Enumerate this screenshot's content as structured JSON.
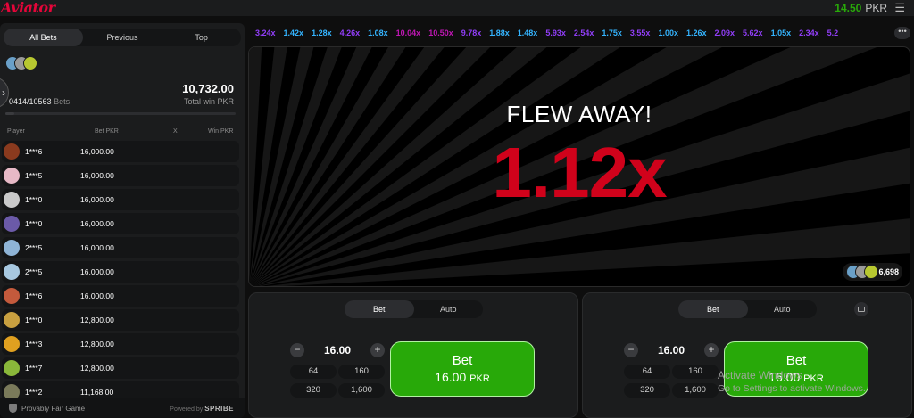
{
  "header": {
    "logo": "Aviator",
    "balance": "14.50",
    "currency": "PKR"
  },
  "left_panel": {
    "tabs": [
      "All Bets",
      "Previous",
      "Top"
    ],
    "bets_count": "0414/10563",
    "bets_label": "Bets",
    "total_win_amount": "10,732.00",
    "total_win_label": "Total win PKR",
    "columns": {
      "player": "Player",
      "bet": "Bet PKR",
      "x": "X",
      "win": "Win PKR"
    },
    "rows": [
      {
        "player": "1***6",
        "bet": "16,000.00",
        "avatar_color": "#8a3a1e"
      },
      {
        "player": "1***5",
        "bet": "16,000.00",
        "avatar_color": "#e7b9c6"
      },
      {
        "player": "1***0",
        "bet": "16,000.00",
        "avatar_color": "#c9c9c9"
      },
      {
        "player": "1***0",
        "bet": "16,000.00",
        "avatar_color": "#6b5aa8"
      },
      {
        "player": "2***5",
        "bet": "16,000.00",
        "avatar_color": "#8fb4d6"
      },
      {
        "player": "2***5",
        "bet": "16,000.00",
        "avatar_color": "#a7c8e0"
      },
      {
        "player": "1***6",
        "bet": "16,000.00",
        "avatar_color": "#c45a3c"
      },
      {
        "player": "1***0",
        "bet": "12,800.00",
        "avatar_color": "#c8a040"
      },
      {
        "player": "1***3",
        "bet": "12,800.00",
        "avatar_color": "#e0a020"
      },
      {
        "player": "1***7",
        "bet": "12,800.00",
        "avatar_color": "#8ab83a"
      },
      {
        "player": "1***2",
        "bet": "11,168.00",
        "avatar_color": "#7a7a5a"
      }
    ],
    "footer_text": "Provably Fair Game",
    "powered_by": "Powered by",
    "brand": "SPRIBE"
  },
  "history": [
    {
      "value": "3.24x",
      "color": "#913ef8"
    },
    {
      "value": "1.42x",
      "color": "#34b4ff"
    },
    {
      "value": "1.28x",
      "color": "#34b4ff"
    },
    {
      "value": "4.26x",
      "color": "#913ef8"
    },
    {
      "value": "1.08x",
      "color": "#34b4ff"
    },
    {
      "value": "10.04x",
      "color": "#c017b4"
    },
    {
      "value": "10.50x",
      "color": "#c017b4"
    },
    {
      "value": "9.78x",
      "color": "#913ef8"
    },
    {
      "value": "1.88x",
      "color": "#34b4ff"
    },
    {
      "value": "1.48x",
      "color": "#34b4ff"
    },
    {
      "value": "5.93x",
      "color": "#913ef8"
    },
    {
      "value": "2.54x",
      "color": "#913ef8"
    },
    {
      "value": "1.75x",
      "color": "#34b4ff"
    },
    {
      "value": "3.55x",
      "color": "#913ef8"
    },
    {
      "value": "1.00x",
      "color": "#34b4ff"
    },
    {
      "value": "1.26x",
      "color": "#34b4ff"
    },
    {
      "value": "2.09x",
      "color": "#913ef8"
    },
    {
      "value": "5.62x",
      "color": "#913ef8"
    },
    {
      "value": "1.05x",
      "color": "#34b4ff"
    },
    {
      "value": "2.34x",
      "color": "#913ef8"
    },
    {
      "value": "5.2",
      "color": "#913ef8"
    }
  ],
  "stage": {
    "flew_text": "FLEW AWAY!",
    "multiplier": "1.12x",
    "online_count": "6,698"
  },
  "bet_panels": [
    {
      "tabs": [
        "Bet",
        "Auto"
      ],
      "amount": "16.00",
      "quick": [
        "64",
        "160",
        "320",
        "1,600"
      ],
      "button_label": "Bet",
      "button_amount": "16.00",
      "button_currency": "PKR"
    },
    {
      "tabs": [
        "Bet",
        "Auto"
      ],
      "amount": "16.00",
      "quick": [
        "64",
        "160",
        "320",
        "1,600"
      ],
      "button_label": "Bet",
      "button_amount": "16.00",
      "button_currency": "PKR"
    }
  ],
  "watermark": {
    "line1": "Activate Windows",
    "line2": "Go to Settings to activate Windows."
  },
  "icons": [
    "menu-icon",
    "chevron-right-icon",
    "shield-icon",
    "more-icon",
    "minus-icon",
    "plus-icon",
    "chat-icon"
  ]
}
